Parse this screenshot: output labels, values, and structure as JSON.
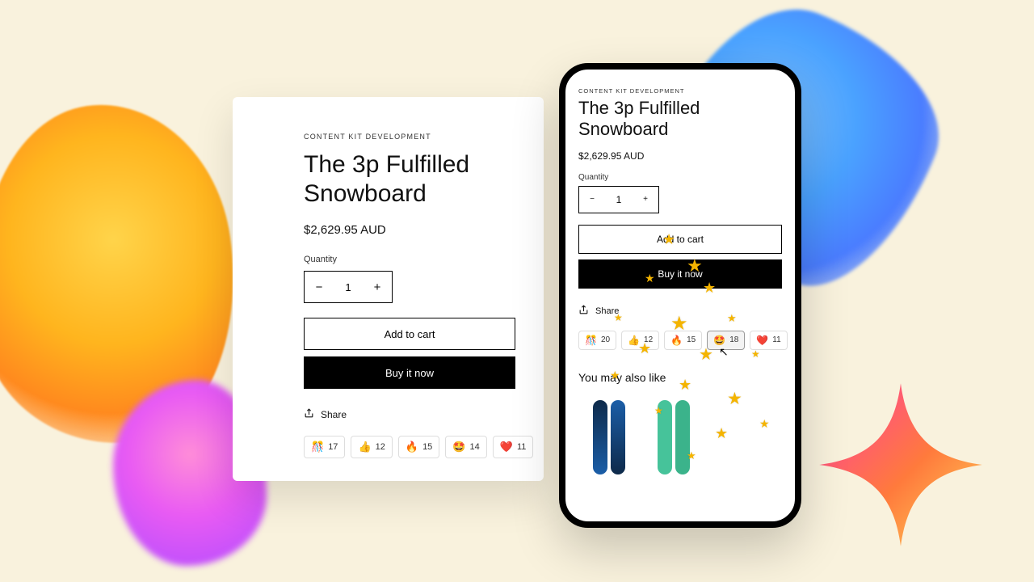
{
  "product": {
    "eyebrow": "CONTENT KIT DEVELOPMENT",
    "title": "The 3p Fulfilled Snowboard",
    "price": "$2,629.95 AUD",
    "quantity_label": "Quantity",
    "quantity_value": "1",
    "add_to_cart": "Add to cart",
    "buy_now": "Buy it now",
    "share_label": "Share"
  },
  "reactions_desktop": [
    {
      "emoji": "🎊",
      "count": "17"
    },
    {
      "emoji": "👍",
      "count": "12"
    },
    {
      "emoji": "🔥",
      "count": "15"
    },
    {
      "emoji": "🤩",
      "count": "14"
    },
    {
      "emoji": "❤️",
      "count": "11"
    }
  ],
  "reactions_mobile": [
    {
      "emoji": "🎊",
      "count": "20"
    },
    {
      "emoji": "👍",
      "count": "12"
    },
    {
      "emoji": "🔥",
      "count": "15"
    },
    {
      "emoji": "🤩",
      "count": "18",
      "active": true
    },
    {
      "emoji": "❤️",
      "count": "11"
    }
  ],
  "recommend_heading": "You may also like"
}
